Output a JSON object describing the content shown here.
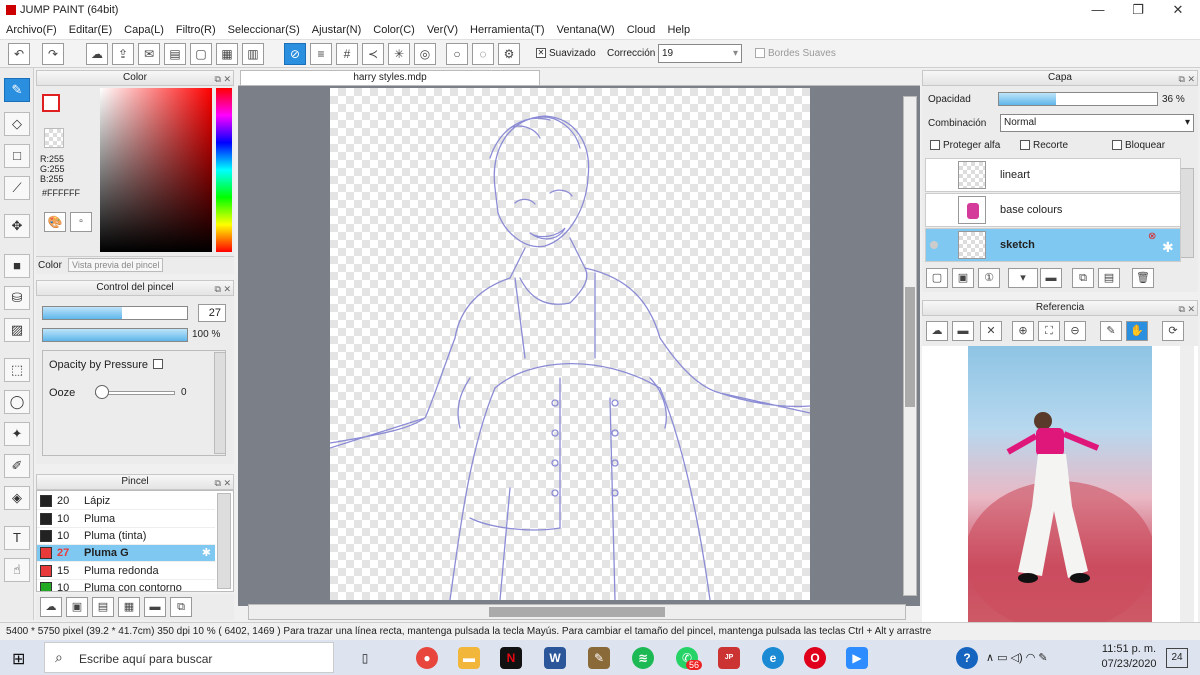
{
  "window": {
    "title": "JUMP PAINT (64bit)",
    "minimize": "—",
    "restore": "❐",
    "close": "✕"
  },
  "menu": [
    "Archivo(F)",
    "Editar(E)",
    "Capa(L)",
    "Filtro(R)",
    "Seleccionar(S)",
    "Ajustar(N)",
    "Color(C)",
    "Ver(V)",
    "Herramienta(T)",
    "Ventana(W)",
    "Cloud",
    "Help"
  ],
  "toolbar": {
    "smoothing_label": "Suavizado",
    "correction_label": "Corrección",
    "correction_value": "19",
    "soft_edges_label": "Bordes Suaves"
  },
  "color_panel": {
    "title": "Color",
    "r": "R:255",
    "g": "G:255",
    "b": "B:255",
    "hex": "#FFFFFF",
    "tab_color": "Color",
    "tab_preview": "Vista previa del pincel"
  },
  "brush_control": {
    "title": "Control del pincel",
    "size": "27",
    "opacity": "100 %",
    "size_fraction": 0.55,
    "opacity_fraction": 1.0,
    "opacity_pressure": "Opacity by Pressure",
    "ooze_label": "Ooze",
    "ooze_value": "0"
  },
  "brush_panel": {
    "title": "Pincel",
    "items": [
      {
        "size": "20",
        "name": "Lápiz",
        "color": "#222222",
        "selected": false
      },
      {
        "size": "10",
        "name": "Pluma",
        "color": "#222222",
        "selected": false
      },
      {
        "size": "10",
        "name": "Pluma (tinta)",
        "color": "#222222",
        "selected": false
      },
      {
        "size": "27",
        "name": "Pluma G",
        "color": "#e83a3a",
        "selected": true
      },
      {
        "size": "15",
        "name": "Pluma redonda",
        "color": "#e83a3a",
        "selected": false
      },
      {
        "size": "10",
        "name": "Pluma con contorno",
        "color": "#22aa22",
        "selected": false
      }
    ]
  },
  "document": {
    "tab_title": "harry styles.mdp"
  },
  "layer_panel": {
    "title": "Capa",
    "opacity_label": "Opacidad",
    "opacity_value": "36 %",
    "opacity_fraction": 0.36,
    "blend_label": "Combinación",
    "blend_value": "Normal",
    "protect_alpha": "Proteger alfa",
    "clipping": "Recorte",
    "lock": "Bloquear",
    "layers": [
      {
        "name": "lineart",
        "selected": false
      },
      {
        "name": "base colours",
        "selected": false
      },
      {
        "name": "sketch",
        "selected": true
      }
    ]
  },
  "reference_panel": {
    "title": "Referencia"
  },
  "status": {
    "text": "5400 * 5750 pixel  (39.2 * 41.7cm)  350 dpi  10 %  ( 6402, 1469 )  Para trazar una línea recta, mantenga pulsada la tecla Mayús. Para cambiar el tamaño del pincel, mantenga pulsada las teclas Ctrl + Alt y arrastre"
  },
  "taskbar": {
    "search_placeholder": "Escribe aquí para buscar",
    "time": "11:51 p. m.",
    "date": "07/23/2020",
    "notifications": "24",
    "whatsapp_badge": "56"
  },
  "colors": {
    "accent": "#2b8fe0",
    "selection": "#7ec8f2",
    "canvas_bg": "#7b7f87"
  }
}
